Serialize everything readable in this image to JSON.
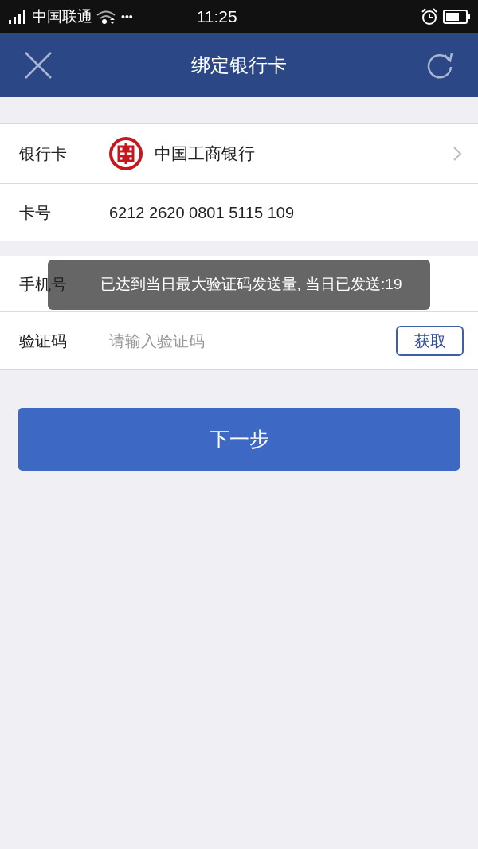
{
  "status_bar": {
    "carrier": "中国联通",
    "dots": "•••",
    "time": "11:25"
  },
  "header": {
    "title": "绑定银行卡"
  },
  "card_section": {
    "bank_label": "银行卡",
    "bank_name": "中国工商银行",
    "number_label": "卡号",
    "number": "6212 2620 0801 5115 109"
  },
  "phone_section": {
    "phone_label": "手机号",
    "code_label": "验证码",
    "code_placeholder": "请输入验证码",
    "get_button": "获取"
  },
  "toast": "已达到当日最大验证码发送量, 当日已发送:19",
  "next_button": "下一步"
}
